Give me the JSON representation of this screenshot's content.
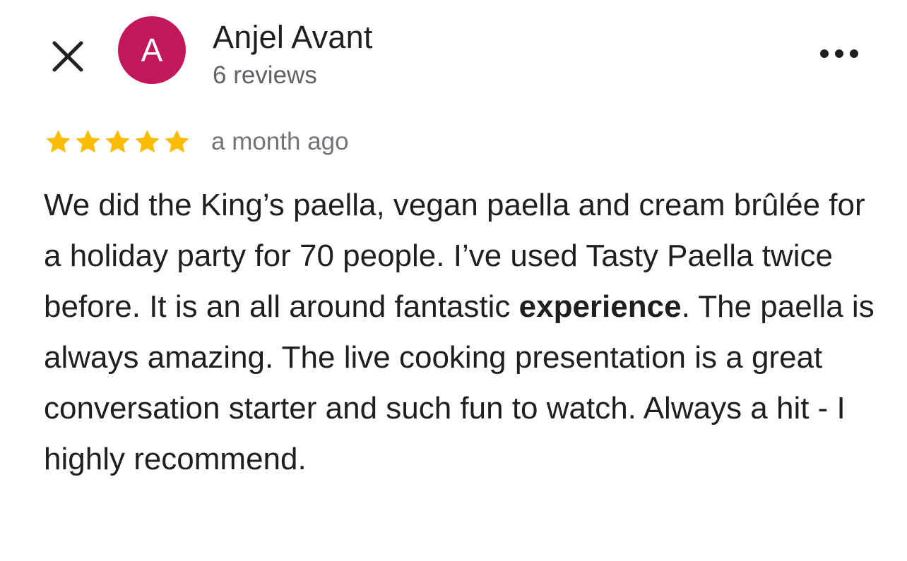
{
  "review": {
    "author": {
      "initial": "A",
      "name": "Anjel Avant",
      "meta": "6 reviews",
      "avatar_color": "#c2185b"
    },
    "rating": 5,
    "star_color": "#fbbc04",
    "time": "a month ago",
    "text_before": "We did the King’s paella, vegan paella and cream brûlée for a holiday party for 70 people. I’ve used Tasty Paella twice before. It is an all around fantastic ",
    "text_bold": "experience",
    "text_after": ". The paella is always amazing. The live cooking presentation is a great conversation starter and such fun to watch. Always a hit - I highly recommend."
  },
  "icons": {
    "close": "close-icon",
    "more": "more-horizontal-icon",
    "star": "star-icon"
  }
}
